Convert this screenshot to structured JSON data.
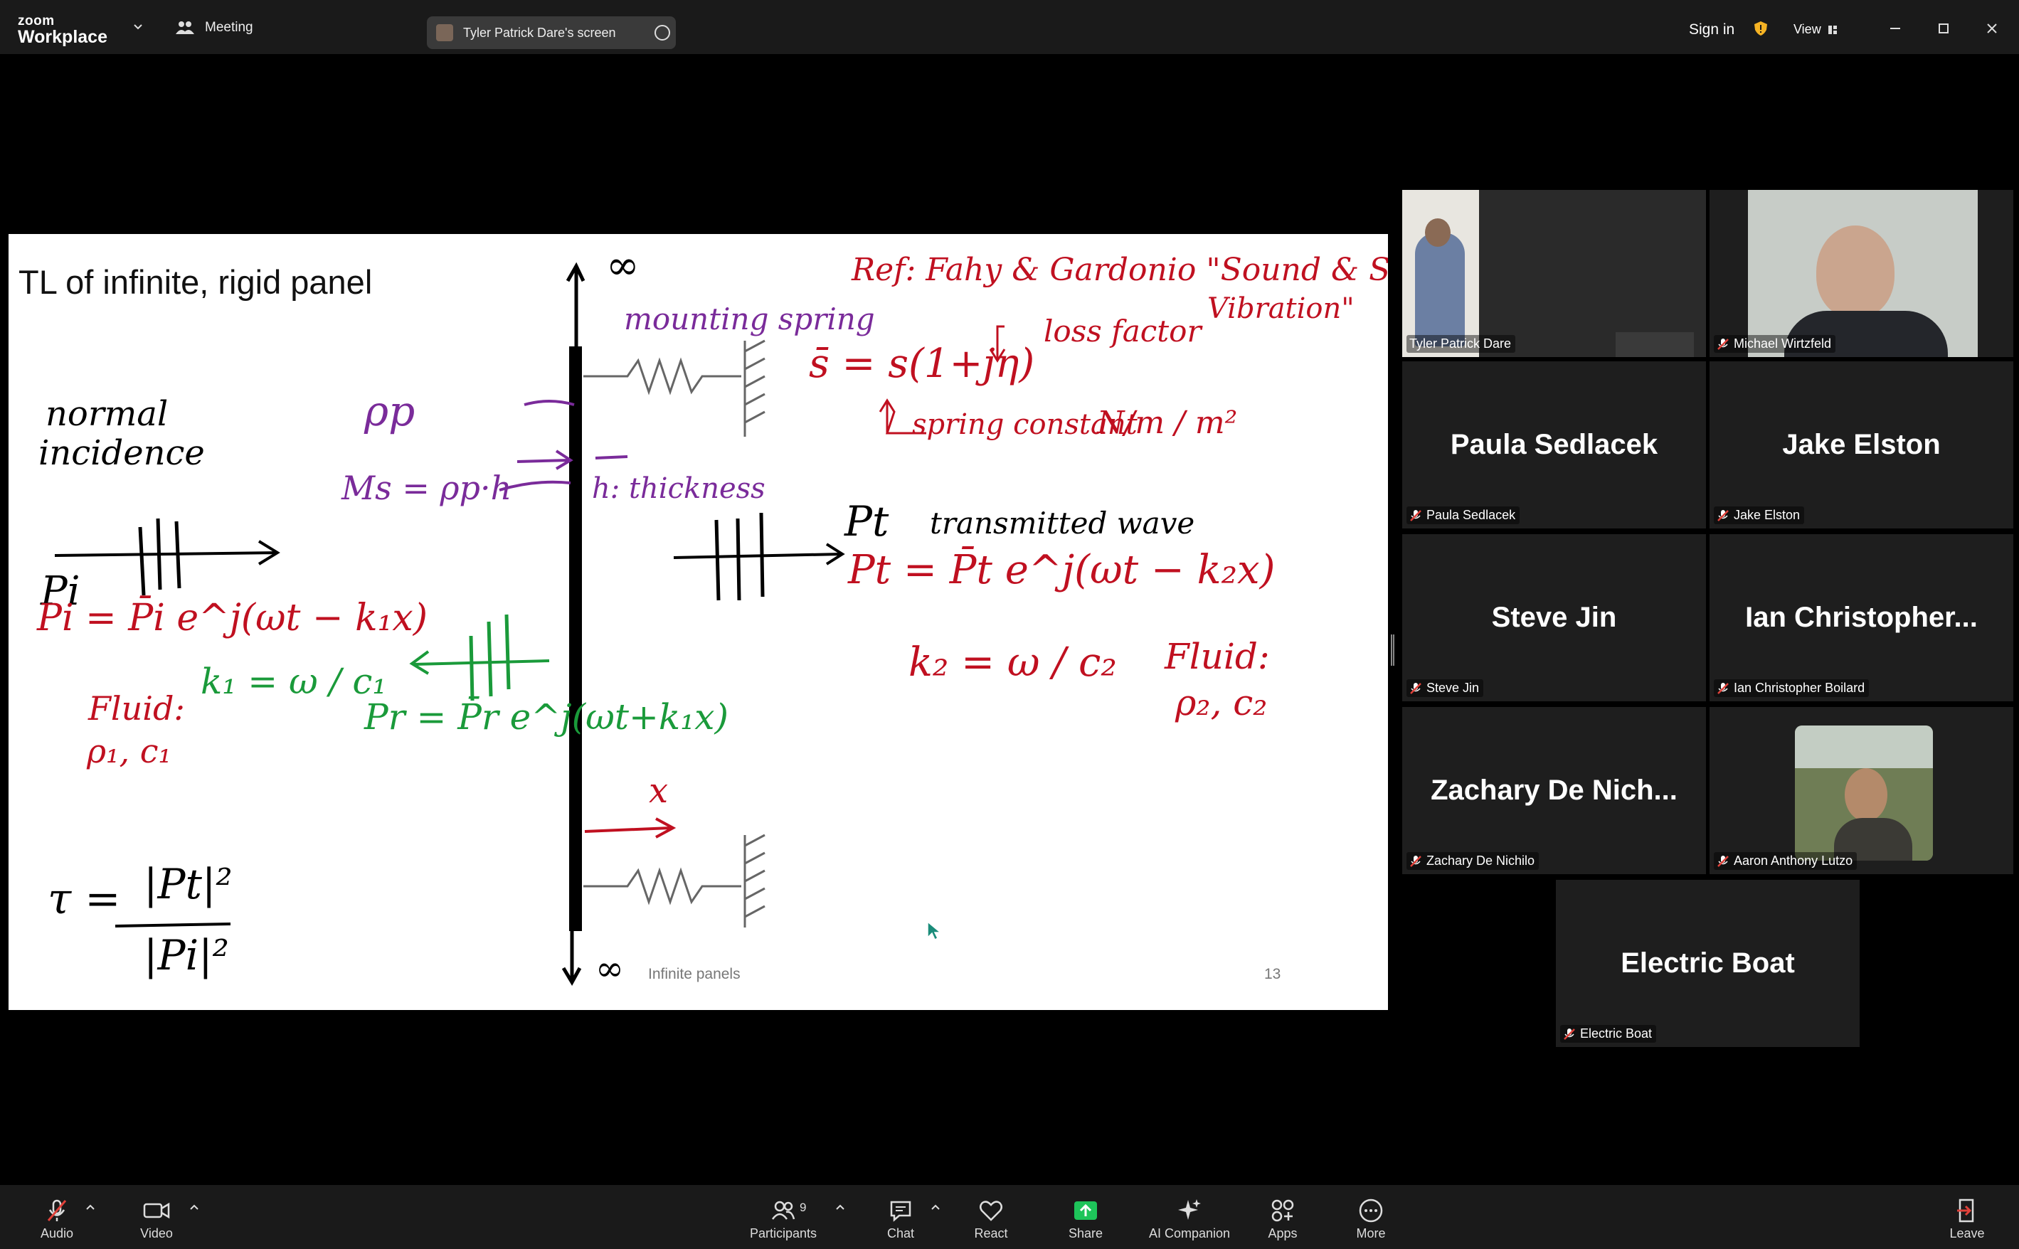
{
  "app": {
    "logo_top": "zoom",
    "logo_bottom": "Workplace",
    "meeting_label": "Meeting",
    "screen_share_label": "Tyler Patrick Dare's screen",
    "sign_in": "Sign in",
    "view_label": "View",
    "colors": {
      "active_speaker": "#3bd66b",
      "share_green": "#1ec45a",
      "mute_red": "#e0413a",
      "shield": "#f5b324"
    }
  },
  "slide": {
    "title": "TL of infinite, rigid panel",
    "footer": "Infinite panels",
    "page_number": "13",
    "handwriting": {
      "infinity_top": "∞",
      "infinity_bottom": "∞",
      "reference": "Ref: Fahy & Gardonio \"Sound & Structural",
      "reference_2": "Vibration\"",
      "mounting_spring": "mounting spring",
      "loss_factor": "loss factor",
      "complex_stiffness": "s̄ = s(1+jη)",
      "spring_constant": "spring constant",
      "units": "N/m / m²",
      "normal_incidence_1": "normal",
      "normal_incidence_2": "incidence",
      "rho_p": "ρp",
      "mass": "Ms = ρp·h",
      "thickness": "h: thickness",
      "pt_label": "Pt",
      "transmitted_wave": "transmitted wave",
      "pi_label": "Pi",
      "pi_eq": "Pi = P̄i e^j(ωt − k₁x)",
      "k1_eq": "k₁ = ω / c₁",
      "fluid1_label": "Fluid:",
      "fluid1_values": "ρ₁, c₁",
      "pr_eq": "Pr = P̄r e^j(ωt+k₁x)",
      "pt_eq": "Pt = P̄t e^j(ωt − k₂x)",
      "k2_eq": "k₂ = ω / c₂",
      "fluid2_label": "Fluid:",
      "fluid2_values": "ρ₂, c₂",
      "x_mark": "x",
      "tau_eq": "τ =",
      "tau_num": "|Pt|²",
      "tau_den": "|Pi|²"
    }
  },
  "participants": [
    {
      "name": "Tyler Patrick Dare",
      "display": "",
      "video": true,
      "active": true
    },
    {
      "name": "Michael Wirtzfeld",
      "display": "",
      "video": true,
      "active": false
    },
    {
      "name": "Paula Sedlacek",
      "display": "Paula Sedlacek"
    },
    {
      "name": "Jake Elston",
      "display": "Jake Elston"
    },
    {
      "name": "Steve Jin",
      "display": "Steve Jin"
    },
    {
      "name": "Ian Christopher Boilard",
      "display": "Ian  Christopher..."
    },
    {
      "name": "Zachary De Nichilo",
      "display": "Zachary  De  Nich..."
    },
    {
      "name": "Aaron Anthony Lutzo",
      "display": "",
      "video": true
    },
    {
      "name": "Electric Boat",
      "display": "Electric Boat"
    }
  ],
  "toolbar": {
    "audio": "Audio",
    "video": "Video",
    "participants": "Participants",
    "participants_count": "9",
    "chat": "Chat",
    "react": "React",
    "share": "Share",
    "ai_companion": "AI Companion",
    "apps": "Apps",
    "more": "More",
    "leave": "Leave"
  }
}
